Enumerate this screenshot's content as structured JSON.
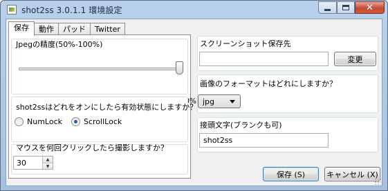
{
  "window": {
    "title": "shot2ss 3.0.1.1 環境設定"
  },
  "tabs": [
    {
      "label": "保存",
      "active": true
    },
    {
      "label": "動作",
      "active": false
    },
    {
      "label": "パッド",
      "active": false
    },
    {
      "label": "Twitter",
      "active": false
    }
  ],
  "jpeg_quality": {
    "label": "Jpegの精度(50%-100%)",
    "value_percent": 100,
    "ticks": [
      "50%",
      "60%",
      "70%",
      "80%",
      "90%",
      "100%"
    ]
  },
  "toggle_key": {
    "label": "shot2ssはどれをオンにしたら有効状態にしますか？",
    "options": [
      {
        "label": "NumLock",
        "checked": false
      },
      {
        "label": "ScrollLock",
        "checked": true
      }
    ]
  },
  "click_count": {
    "label": "マウスを何回クリックしたら撮影しますか？",
    "value": "30"
  },
  "save_location": {
    "label": "スクリーンショット保存先",
    "path": "",
    "change_button": "変更"
  },
  "image_format": {
    "label": "画像のフォーマットはどれにしますか？",
    "selected": "jpg"
  },
  "prefix": {
    "label": "接頭文字(ブランクも可)",
    "value": "shot2ss"
  },
  "footer": {
    "save_button": "保存 (S)",
    "cancel_button": "キャンセル (X)"
  }
}
